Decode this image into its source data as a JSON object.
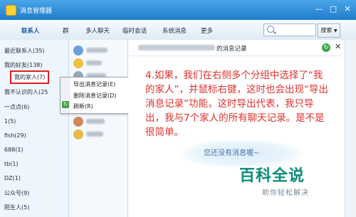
{
  "window": {
    "title": "消息管理器",
    "minimize": "—",
    "maximize": "□",
    "close": "✕"
  },
  "toolbar": {
    "tabs": [
      "联系人",
      "群",
      "多人聊天",
      "临时会话",
      "系统消息",
      "更多"
    ],
    "search_placeholder": "",
    "search_button": "搜索",
    "search_button_arrow": "▼"
  },
  "sidebar": {
    "groups": [
      "最近联系人(35)",
      "我的好友(138)",
      "我的家人(7)",
      "我不认识的人(25",
      "一点点(6)",
      "1(5)",
      "fish(29)",
      "688(1)",
      "tb(1)",
      "DZ(1)",
      "公众号(9)",
      "陌生人(5)"
    ],
    "selected_index": 2
  },
  "context_menu": {
    "items": [
      "导出消息记录(E)",
      "删除消息记录(D)",
      "刷新(R)"
    ],
    "refresh_icon": "↻"
  },
  "main": {
    "header_title": "的消息记录",
    "annotation": "4.如果，我们在右侧多个分组中选择了“我的家人”，并鼠标右键，这时也会出现“导出消息记录”功能，这时导出代表，我只导出，我与7个家人的所有聊天记录。是不是很简单。",
    "empty_message": "您还没有消息喔~",
    "export_icon": "↻",
    "close_icon": "✕"
  },
  "watermark": {
    "title": "百科全说",
    "subtitle": "助你轻松解决"
  },
  "colors": {
    "titlebar": "#1f7ccc",
    "annotation": "#e0312d",
    "selection_border": "#e02020",
    "watermark": "#0a8c7a"
  }
}
